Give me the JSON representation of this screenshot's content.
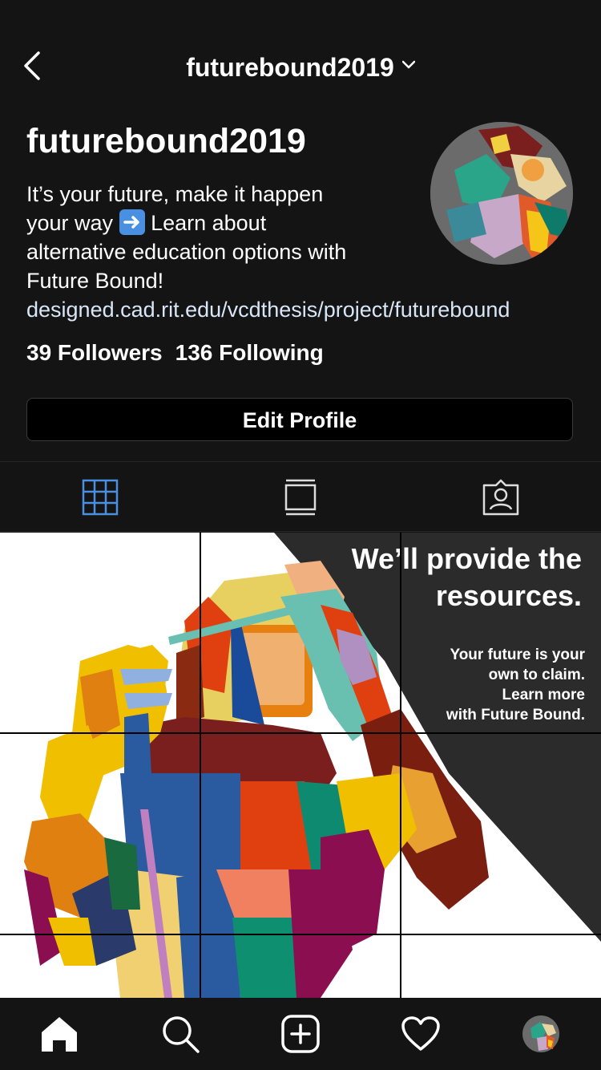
{
  "header": {
    "username": "futurebound2019"
  },
  "profile": {
    "name": "futurebound2019",
    "bio_lines": [
      "It’s your future, make it happen",
      "your way",
      "Learn about",
      "alternative education options with",
      "Future Bound!"
    ],
    "link": "designed.cad.rit.edu/vcdthesis/project/futurebound",
    "followers": "39 Followers",
    "following": "136 Following",
    "edit_button": "Edit Profile"
  },
  "post": {
    "headline_1": "We’ll provide the",
    "headline_2": "resources.",
    "sub_1": "Your future is your",
    "sub_2": "own to claim.",
    "sub_3": "Learn more",
    "sub_4": "with Future Bound."
  },
  "colors": {
    "background": "#141414",
    "accent_blue": "#4a90e2",
    "link": "#d8e6f7"
  },
  "tabs": [
    "grid-icon",
    "feed-icon",
    "tagged-icon"
  ],
  "nav": [
    "home-icon",
    "search-icon",
    "add-post-icon",
    "heart-icon",
    "profile-avatar"
  ]
}
